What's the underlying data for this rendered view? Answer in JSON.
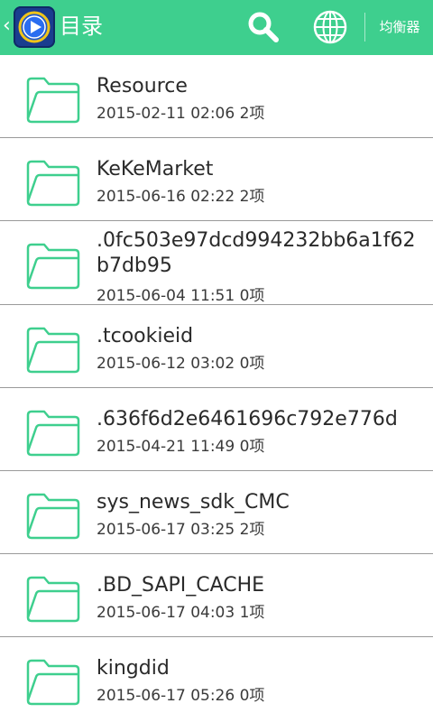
{
  "header": {
    "back_glyph": "‹",
    "title": "目录",
    "equalizer_label": "均衡器",
    "icons": {
      "back": "chevron-left-icon",
      "logo": "player-logo-icon",
      "search": "search-icon",
      "globe": "globe-icon"
    },
    "colors": {
      "bar": "#3ecf8e",
      "text": "#ffffff"
    }
  },
  "folders": [
    {
      "name": "Resource",
      "date": "2015-02-11 02:06",
      "count": "2项"
    },
    {
      "name": "KeKeMarket",
      "date": "2015-06-16 02:22",
      "count": "2项"
    },
    {
      "name": ".0fc503e97dcd994232bb6a1f62b7db95",
      "date": "2015-06-04 11:51",
      "count": "0项"
    },
    {
      "name": ".tcookieid",
      "date": "2015-06-12 03:02",
      "count": "0项"
    },
    {
      "name": ".636f6d2e6461696c792e776d",
      "date": "2015-04-21 11:49",
      "count": "0项"
    },
    {
      "name": "sys_news_sdk_CMC",
      "date": "2015-06-17 03:25",
      "count": "2项"
    },
    {
      "name": ".BD_SAPI_CACHE",
      "date": "2015-06-17 04:03",
      "count": "1项"
    },
    {
      "name": "kingdid",
      "date": "2015-06-17 05:26",
      "count": "0项"
    }
  ],
  "folder_icon": {
    "name": "folder-icon",
    "stroke": "#3ecf8e"
  }
}
